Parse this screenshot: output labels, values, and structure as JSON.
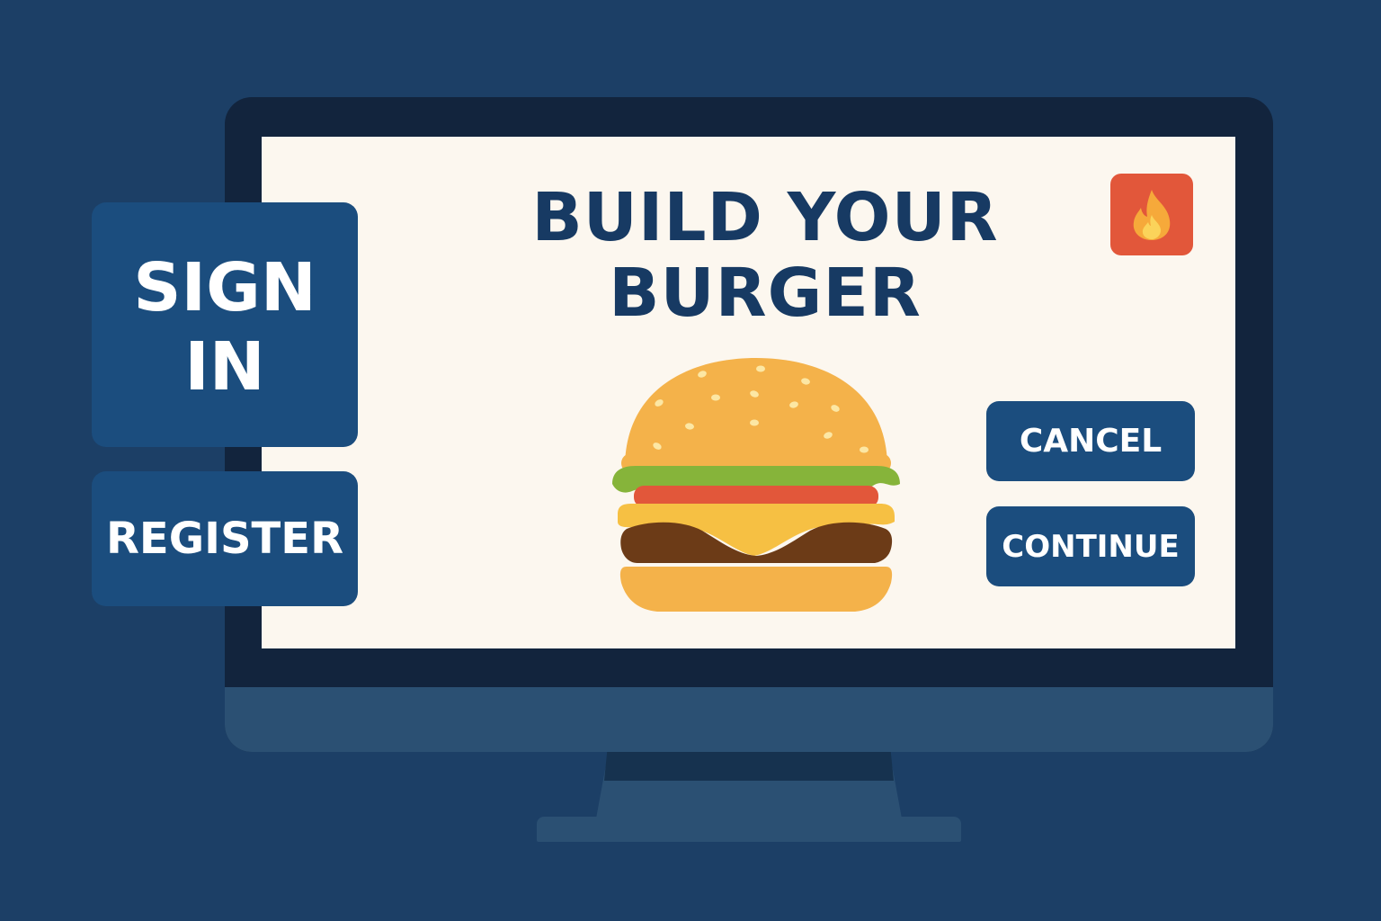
{
  "screen": {
    "title_line1": "BUILD YOUR",
    "title_line2": "BURGER",
    "badge_icon": "fire-icon",
    "cancel_label": "CANCEL",
    "continue_label": "CONTINUE",
    "illustration": "burger-illustration"
  },
  "auth": {
    "signin_line1": "SIGN",
    "signin_line2": "IN",
    "register_label": "REGISTER"
  },
  "colors": {
    "background": "#1c3f66",
    "screen": "#fcf7ef",
    "button": "#1b4d7e",
    "title": "#173a63",
    "badge": "#e2573a"
  }
}
